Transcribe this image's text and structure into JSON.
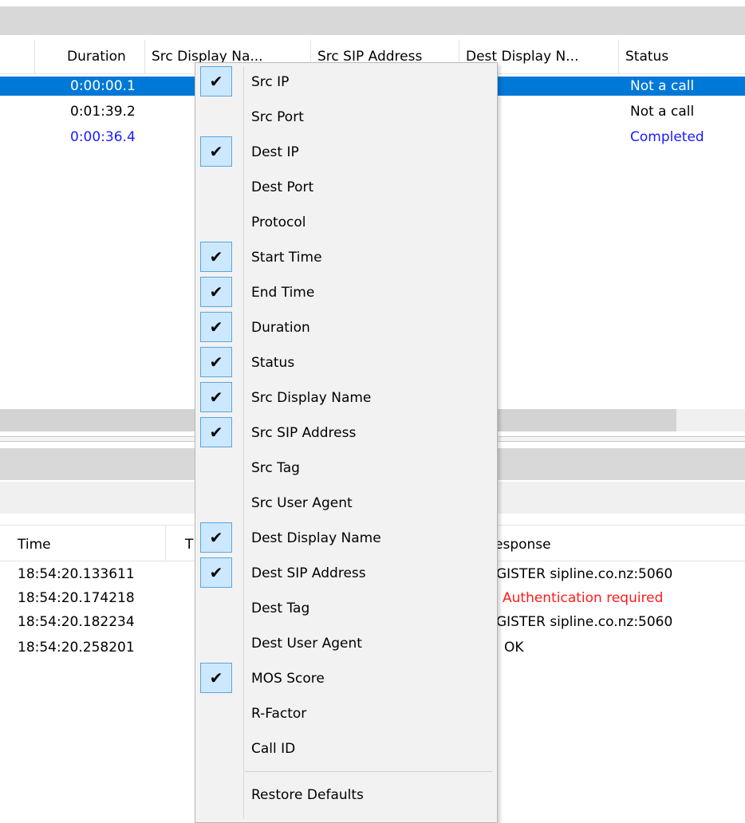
{
  "call_list": {
    "columns": [
      "Duration",
      "Src Display Na...",
      "Src SIP Address",
      "Dest Display N...",
      "Status"
    ],
    "rows": [
      {
        "duration": "0:00:00.1",
        "status": "Not a call",
        "selected": true
      },
      {
        "duration": "0:01:39.2",
        "status": "Not a call",
        "selected": false
      },
      {
        "duration": "0:00:36.4",
        "status": "Completed",
        "selected": false
      }
    ]
  },
  "message_list": {
    "columns": [
      "Time",
      "T",
      "esponse"
    ],
    "rows": [
      {
        "time": "18:54:20.133611",
        "response": "GISTER sipline.co.nz:5060"
      },
      {
        "time": "18:54:20.174218",
        "response": "Authentication required"
      },
      {
        "time": "18:54:20.182234",
        "response": "GISTER sipline.co.nz:5060"
      },
      {
        "time": "18:54:20.258201",
        "response": "OK"
      }
    ]
  },
  "context_menu": {
    "check_glyph": "✔",
    "items": [
      {
        "label": "Src IP",
        "checked": true
      },
      {
        "label": "Src Port",
        "checked": false
      },
      {
        "label": "Dest IP",
        "checked": true
      },
      {
        "label": "Dest Port",
        "checked": false
      },
      {
        "label": "Protocol",
        "checked": false
      },
      {
        "label": "Start Time",
        "checked": true
      },
      {
        "label": "End Time",
        "checked": true
      },
      {
        "label": "Duration",
        "checked": true
      },
      {
        "label": "Status",
        "checked": true
      },
      {
        "label": "Src Display Name",
        "checked": true
      },
      {
        "label": "Src SIP Address",
        "checked": true
      },
      {
        "label": "Src Tag",
        "checked": false
      },
      {
        "label": "Src User Agent",
        "checked": false
      },
      {
        "label": "Dest Display Name",
        "checked": true
      },
      {
        "label": "Dest SIP Address",
        "checked": true
      },
      {
        "label": "Dest Tag",
        "checked": false
      },
      {
        "label": "Dest User Agent",
        "checked": false
      },
      {
        "label": "MOS Score",
        "checked": true
      },
      {
        "label": "R-Factor",
        "checked": false
      },
      {
        "label": "Call ID",
        "checked": false
      }
    ],
    "restore_defaults": "Restore Defaults"
  }
}
